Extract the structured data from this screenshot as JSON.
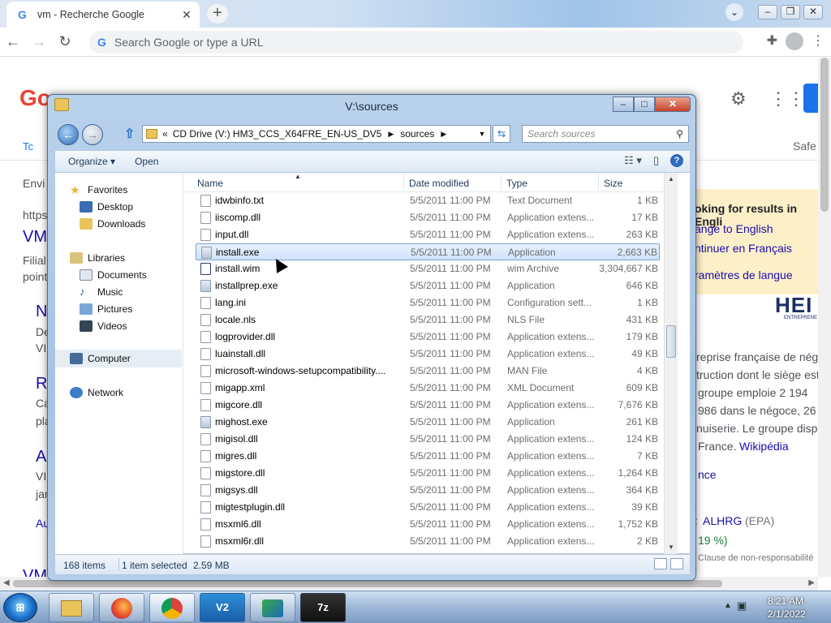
{
  "chrome": {
    "tab_title": "vm - Recherche Google",
    "omnibox_placeholder": "Search Google or type a URL"
  },
  "google": {
    "logo": "Go",
    "safe": "Safe",
    "tabs_first": "Tc",
    "left_texts": [
      "Envi",
      "https",
      "VM",
      "Filial",
      "point",
      "N",
      "De",
      "VI",
      "R",
      "Ca",
      "pla",
      "A",
      "VI",
      "jar",
      "Au",
      "VM"
    ],
    "panel": {
      "title": "oking for results in Engli",
      "link1": "ange to English",
      "link2": "ntinuer en Français",
      "link3": "ramètres de langue"
    },
    "brand": "HEI",
    "brand_sub": "ENTREPRENE",
    "right_texts": {
      "l1": "reprise française de négo",
      "l2": "truction dont le siège est",
      "l3": "groupe emploie 2 194",
      "l4": "986 dans le négoce, 26",
      "l5": "nuiserie. Le groupe disp",
      "l6": "France.",
      "wiki": "Wikipédia",
      "nce": "nce",
      "ticker_label": ":",
      "ticker": "ALHRG",
      "ticker_ex": "(EPA)",
      "pct": "19 %)",
      "disclaimer": "Clause de non-responsabilité"
    }
  },
  "explorer": {
    "title": "V:\\sources",
    "address": {
      "chevrons": "«",
      "drive": "CD Drive (V:) HM3_CCS_X64FRE_EN-US_DV5",
      "folder": "sources"
    },
    "search_placeholder": "Search sources",
    "commands": {
      "organize": "Organize",
      "open": "Open"
    },
    "nav": {
      "favorites": "Favorites",
      "desktop": "Desktop",
      "downloads": "Downloads",
      "libraries": "Libraries",
      "documents": "Documents",
      "music": "Music",
      "pictures": "Pictures",
      "videos": "Videos",
      "computer": "Computer",
      "network": "Network"
    },
    "columns": {
      "name": "Name",
      "date": "Date modified",
      "type": "Type",
      "size": "Size"
    },
    "files": [
      {
        "name": "idwbinfo.txt",
        "date": "5/5/2011 11:00 PM",
        "type": "Text Document",
        "size": "1 KB"
      },
      {
        "name": "iiscomp.dll",
        "date": "5/5/2011 11:00 PM",
        "type": "Application extens...",
        "size": "17 KB"
      },
      {
        "name": "input.dll",
        "date": "5/5/2011 11:00 PM",
        "type": "Application extens...",
        "size": "263 KB"
      },
      {
        "name": "install.exe",
        "date": "5/5/2011 11:00 PM",
        "type": "Application",
        "size": "2,663 KB"
      },
      {
        "name": "install.wim",
        "date": "5/5/2011 11:00 PM",
        "type": "wim Archive",
        "size": "3,304,667 KB"
      },
      {
        "name": "installprep.exe",
        "date": "5/5/2011 11:00 PM",
        "type": "Application",
        "size": "646 KB"
      },
      {
        "name": "lang.ini",
        "date": "5/5/2011 11:00 PM",
        "type": "Configuration sett...",
        "size": "1 KB"
      },
      {
        "name": "locale.nls",
        "date": "5/5/2011 11:00 PM",
        "type": "NLS File",
        "size": "431 KB"
      },
      {
        "name": "logprovider.dll",
        "date": "5/5/2011 11:00 PM",
        "type": "Application extens...",
        "size": "179 KB"
      },
      {
        "name": "luainstall.dll",
        "date": "5/5/2011 11:00 PM",
        "type": "Application extens...",
        "size": "49 KB"
      },
      {
        "name": "microsoft-windows-setupcompatibility....",
        "date": "5/5/2011 11:00 PM",
        "type": "MAN File",
        "size": "4 KB"
      },
      {
        "name": "migapp.xml",
        "date": "5/5/2011 11:00 PM",
        "type": "XML Document",
        "size": "609 KB"
      },
      {
        "name": "migcore.dll",
        "date": "5/5/2011 11:00 PM",
        "type": "Application extens...",
        "size": "7,676 KB"
      },
      {
        "name": "mighost.exe",
        "date": "5/5/2011 11:00 PM",
        "type": "Application",
        "size": "261 KB"
      },
      {
        "name": "migisol.dll",
        "date": "5/5/2011 11:00 PM",
        "type": "Application extens...",
        "size": "124 KB"
      },
      {
        "name": "migres.dll",
        "date": "5/5/2011 11:00 PM",
        "type": "Application extens...",
        "size": "7 KB"
      },
      {
        "name": "migstore.dll",
        "date": "5/5/2011 11:00 PM",
        "type": "Application extens...",
        "size": "1,264 KB"
      },
      {
        "name": "migsys.dll",
        "date": "5/5/2011 11:00 PM",
        "type": "Application extens...",
        "size": "364 KB"
      },
      {
        "name": "migtestplugin.dll",
        "date": "5/5/2011 11:00 PM",
        "type": "Application extens...",
        "size": "39 KB"
      },
      {
        "name": "msxml6.dll",
        "date": "5/5/2011 11:00 PM",
        "type": "Application extens...",
        "size": "1,752 KB"
      },
      {
        "name": "msxml6r.dll",
        "date": "5/5/2011 11:00 PM",
        "type": "Application extens...",
        "size": "2 KB"
      }
    ],
    "status": {
      "count": "168 items",
      "selected": "1 item selected",
      "size": "2.59 MB"
    }
  },
  "taskbar": {
    "vs_label": "V2",
    "sevenzip_label": "7z",
    "time": "8:21 AM",
    "date": "2/1/2022"
  }
}
